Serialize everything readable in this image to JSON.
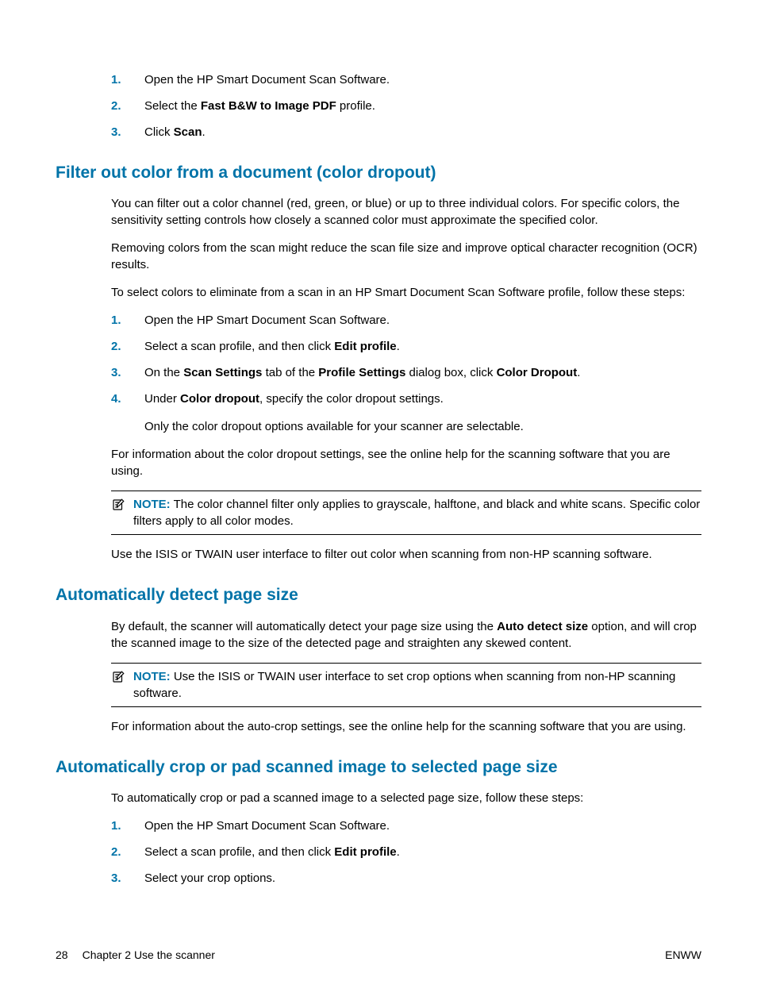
{
  "intro_numbered": [
    {
      "n": "1.",
      "parts": [
        {
          "t": "Open the HP Smart Document Scan Software."
        }
      ]
    },
    {
      "n": "2.",
      "parts": [
        {
          "t": "Select the "
        },
        {
          "t": "Fast B&W to Image PDF",
          "b": true
        },
        {
          "t": " profile."
        }
      ]
    },
    {
      "n": "3.",
      "parts": [
        {
          "t": "Click "
        },
        {
          "t": "Scan",
          "b": true
        },
        {
          "t": "."
        }
      ]
    }
  ],
  "sec1": {
    "heading": "Filter out color from a document (color dropout)",
    "p1": "You can filter out a color channel (red, green, or blue) or up to three individual colors. For specific colors, the sensitivity setting controls how closely a scanned color must approximate the specified color.",
    "p2": "Removing colors from the scan might reduce the scan file size and improve optical character recognition (OCR) results.",
    "p3": "To select colors to eliminate from a scan in an HP Smart Document Scan Software profile, follow these steps:",
    "list": [
      {
        "n": "1.",
        "parts": [
          {
            "t": "Open the HP Smart Document Scan Software."
          }
        ]
      },
      {
        "n": "2.",
        "parts": [
          {
            "t": "Select a scan profile, and then click "
          },
          {
            "t": "Edit profile",
            "b": true
          },
          {
            "t": "."
          }
        ]
      },
      {
        "n": "3.",
        "parts": [
          {
            "t": "On the "
          },
          {
            "t": "Scan Settings",
            "b": true
          },
          {
            "t": " tab of the "
          },
          {
            "t": "Profile Settings",
            "b": true
          },
          {
            "t": " dialog box, click "
          },
          {
            "t": "Color Dropout",
            "b": true
          },
          {
            "t": "."
          }
        ]
      },
      {
        "n": "4.",
        "parts": [
          {
            "t": "Under "
          },
          {
            "t": "Color dropout",
            "b": true
          },
          {
            "t": ", specify the color dropout settings."
          }
        ]
      }
    ],
    "sub": "Only the color dropout options available for your scanner are selectable.",
    "p4": "For information about the color dropout settings, see the online help for the scanning software that you are using.",
    "note_label": "NOTE:",
    "note": "The color channel filter only applies to grayscale, halftone, and black and white scans. Specific color filters apply to all color modes.",
    "p5": "Use the ISIS or TWAIN user interface to filter out color when scanning from non-HP scanning software."
  },
  "sec2": {
    "heading": "Automatically detect page size",
    "p1_parts": [
      {
        "t": "By default, the scanner will automatically detect your page size using the "
      },
      {
        "t": "Auto detect size",
        "b": true
      },
      {
        "t": " option, and will crop the scanned image to the size of the detected page and straighten any skewed content."
      }
    ],
    "note_label": "NOTE:",
    "note": "Use the ISIS or TWAIN user interface to set crop options when scanning from non-HP scanning software.",
    "p2": "For information about the auto-crop settings, see the online help for the scanning software that you are using."
  },
  "sec3": {
    "heading": "Automatically crop or pad scanned image to selected page size",
    "p1": "To automatically crop or pad a scanned image to a selected page size, follow these steps:",
    "list": [
      {
        "n": "1.",
        "parts": [
          {
            "t": "Open the HP Smart Document Scan Software."
          }
        ]
      },
      {
        "n": "2.",
        "parts": [
          {
            "t": "Select a scan profile, and then click "
          },
          {
            "t": "Edit profile",
            "b": true
          },
          {
            "t": "."
          }
        ]
      },
      {
        "n": "3.",
        "parts": [
          {
            "t": "Select your crop options."
          }
        ]
      }
    ]
  },
  "footer": {
    "page": "28",
    "chapter": "Chapter 2   Use the scanner",
    "right": "ENWW"
  }
}
